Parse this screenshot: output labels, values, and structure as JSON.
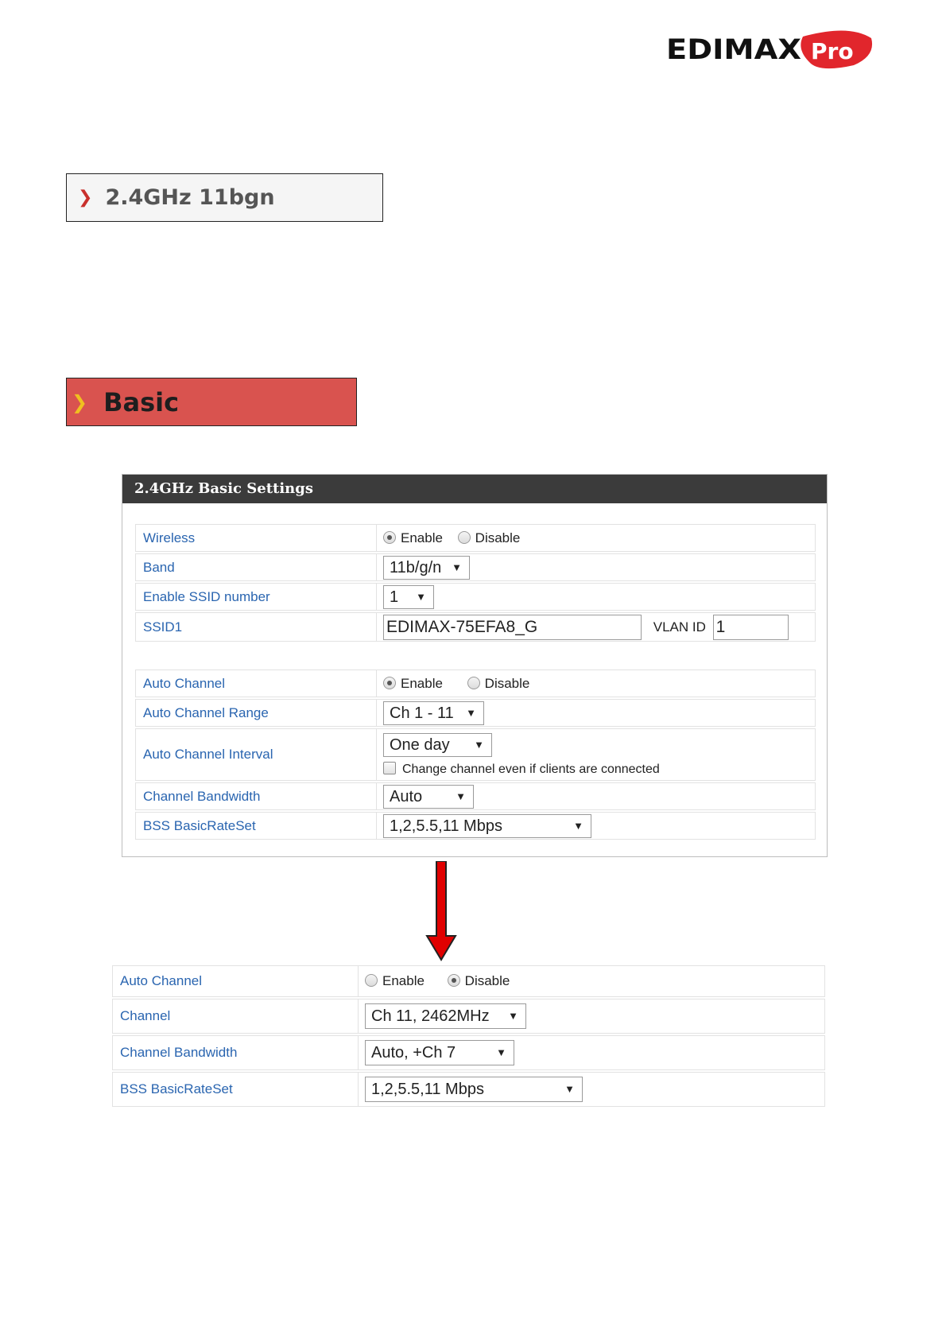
{
  "brand": {
    "name": "EDIMAX",
    "suffix": "Pro",
    "accent": "#e1262c"
  },
  "nav": {
    "band_label": "2.4GHz 11bgn",
    "basic_label": "Basic",
    "basic_color": "#d9534f"
  },
  "panel": {
    "title": "2.4GHz Basic Settings",
    "rows": {
      "wireless": {
        "label": "Wireless",
        "opt_enable": "Enable",
        "opt_disable": "Disable",
        "selected": "Enable"
      },
      "band": {
        "label": "Band",
        "value": "11b/g/n"
      },
      "ssid_number": {
        "label": "Enable SSID number",
        "value": "1"
      },
      "ssid1": {
        "label": "SSID1",
        "value": "EDIMAX-75EFA8_G",
        "vlan_label": "VLAN ID",
        "vlan_value": "1"
      },
      "auto_channel": {
        "label": "Auto Channel",
        "opt_enable": "Enable",
        "opt_disable": "Disable",
        "selected": "Enable"
      },
      "auto_channel_range": {
        "label": "Auto Channel Range",
        "value": "Ch 1 - 11"
      },
      "auto_channel_interval": {
        "label": "Auto Channel Interval",
        "value": "One day",
        "checkbox_label": "Change channel even if clients are connected",
        "checked": false
      },
      "channel_bandwidth": {
        "label": "Channel Bandwidth",
        "value": "Auto"
      },
      "bss_basic_rate_set": {
        "label": "BSS BasicRateSet",
        "value": "1,2,5.5,11 Mbps"
      }
    }
  },
  "disabled_panel": {
    "rows": {
      "auto_channel": {
        "label": "Auto Channel",
        "opt_enable": "Enable",
        "opt_disable": "Disable",
        "selected": "Disable"
      },
      "channel": {
        "label": "Channel",
        "value": "Ch 11, 2462MHz"
      },
      "channel_bandwidth": {
        "label": "Channel Bandwidth",
        "value": "Auto, +Ch 7"
      },
      "bss_basic_rate_set": {
        "label": "BSS BasicRateSet",
        "value": "1,2,5.5,11 Mbps"
      }
    }
  },
  "icons": {
    "chevron": "chevron-right-icon",
    "dropdown": "triangle-down-icon",
    "arrow": "arrow-down-icon"
  },
  "colors": {
    "label_blue": "#2a65b0",
    "header_dark": "#3b3b3b",
    "arrow_red": "#e00000"
  }
}
